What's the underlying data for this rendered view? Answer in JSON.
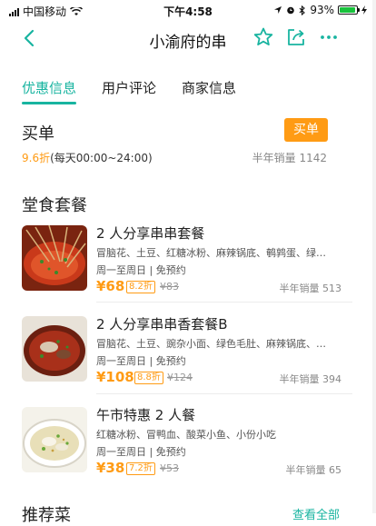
{
  "status_bar": {
    "carrier": "中国移动",
    "time": "下午4:58",
    "battery": "93%",
    "battery_level": 0.93
  },
  "nav": {
    "title": "小渝府的串"
  },
  "tabs": [
    {
      "label": "优惠信息",
      "active": true
    },
    {
      "label": "用户评论",
      "active": false
    },
    {
      "label": "商家信息",
      "active": false
    }
  ],
  "buy_section": {
    "title": "买单",
    "button": "买单",
    "discount": "9.6折",
    "hours": "(每天00:00~24:00)",
    "sales": "半年销量 1142"
  },
  "dine_section": {
    "title": "堂食套餐"
  },
  "deals": [
    {
      "name": "2 人分享串串套餐",
      "desc": "冒脑花、土豆、红糖冰粉、麻辣锅底、鹌鹑蛋、绿…",
      "availability": "周一至周日 | 免预约",
      "price": "¥68",
      "tag": "8.2折",
      "original": "¥83",
      "sales": "半年销量 513"
    },
    {
      "name": "2 人分享串串香套餐B",
      "desc": "冒脑花、土豆、豌杂小面、绿色毛肚、麻辣锅底、…",
      "availability": "周一至周日 | 免预约",
      "price": "¥108",
      "tag": "8.8折",
      "original": "¥124",
      "sales": "半年销量 394"
    },
    {
      "name": "午市特惠 2 人餐",
      "desc": "红糖冰粉、冒鸭血、酸菜小鱼、小份小吃",
      "availability": "周一至周日 | 免预约",
      "price": "¥38",
      "tag": "7.2折",
      "original": "¥53",
      "sales": "半年销量 65"
    }
  ],
  "recommend": {
    "title": "推荐菜",
    "link": "查看全部"
  },
  "colors": {
    "accent": "#18b4a0",
    "price": "#ff9b14"
  }
}
